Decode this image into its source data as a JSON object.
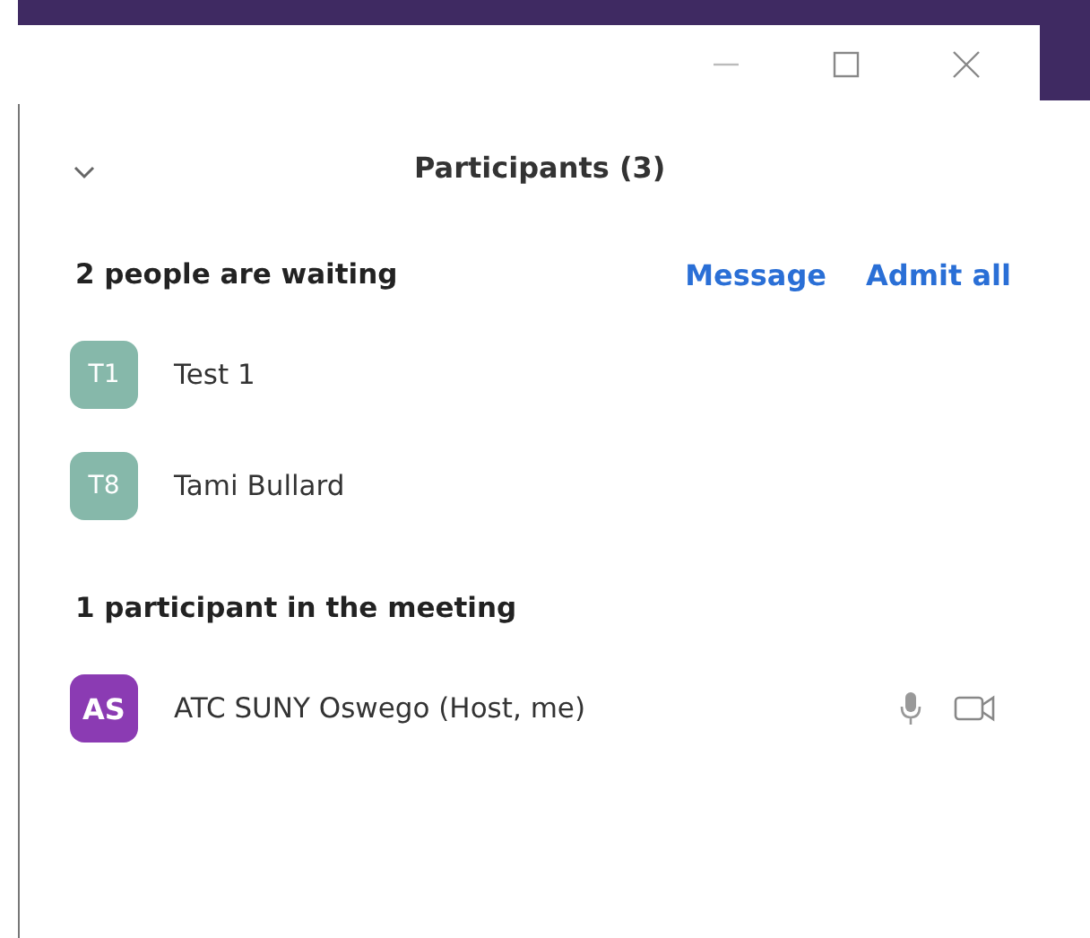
{
  "panel": {
    "title": "Participants (3)"
  },
  "waiting": {
    "heading": "2 people are waiting",
    "actions": [
      "Message",
      "Admit all"
    ],
    "people": [
      {
        "initials": "T1",
        "name": "Test 1",
        "color": "#86b8aa"
      },
      {
        "initials": "T8",
        "name": "Tami Bullard",
        "color": "#86b8aa"
      }
    ]
  },
  "meeting": {
    "heading": "1 participant in the meeting",
    "people": [
      {
        "initials": "AS",
        "name": "ATC SUNY Oswego (Host, me)",
        "color": "#8b3bb3"
      }
    ]
  }
}
